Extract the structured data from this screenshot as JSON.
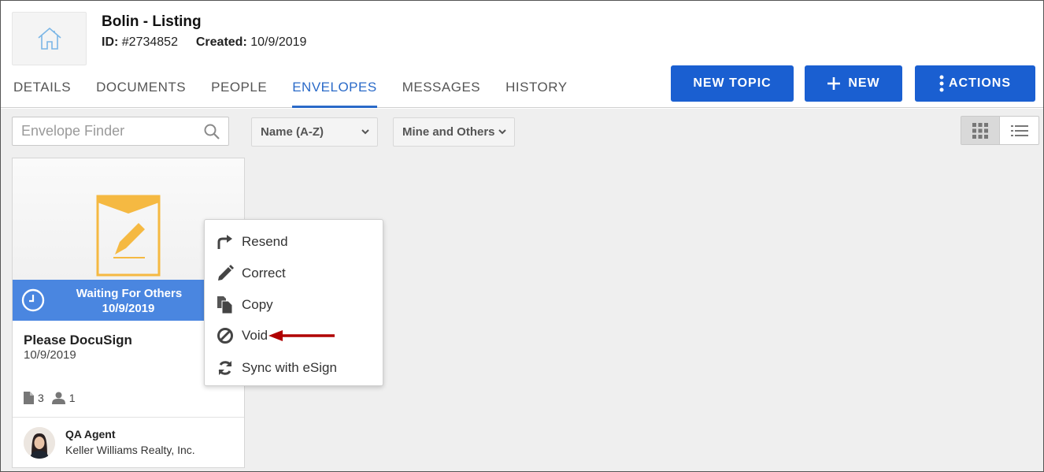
{
  "listing": {
    "title": "Bolin - Listing",
    "id_label": "ID:",
    "id_value": "#2734852",
    "created_label": "Created:",
    "created_value": "10/9/2019"
  },
  "tabs": [
    {
      "label": "DETAILS"
    },
    {
      "label": "DOCUMENTS"
    },
    {
      "label": "PEOPLE"
    },
    {
      "label": "ENVELOPES",
      "active": true
    },
    {
      "label": "MESSAGES"
    },
    {
      "label": "HISTORY"
    }
  ],
  "buttons": {
    "new_topic": "NEW TOPIC",
    "new": "NEW",
    "actions": "ACTIONS"
  },
  "toolbar": {
    "search_placeholder": "Envelope Finder",
    "sort_value": "Name (A-Z)",
    "filter_value": "Mine and Others"
  },
  "envelope": {
    "status_line1": "Waiting For Others",
    "status_line2": "10/9/2019",
    "name": "Please DocuSign",
    "date": "10/9/2019",
    "doc_count": "3",
    "people_count": "1",
    "agent_name": "QA Agent",
    "agent_company": "Keller Williams Realty, Inc."
  },
  "menu": {
    "items": [
      {
        "label": "Resend",
        "icon": "resend-icon"
      },
      {
        "label": "Correct",
        "icon": "pencil-icon"
      },
      {
        "label": "Copy",
        "icon": "copy-icon"
      },
      {
        "label": "Void",
        "icon": "void-icon"
      },
      {
        "label": "Sync with eSign",
        "icon": "sync-icon"
      }
    ]
  },
  "colors": {
    "primary": "#1a5fd1",
    "tab_active": "#2a6ac8",
    "status_banner": "#4a86e0",
    "envelope_icon": "#f5b942",
    "annotation_arrow": "#b00000"
  }
}
